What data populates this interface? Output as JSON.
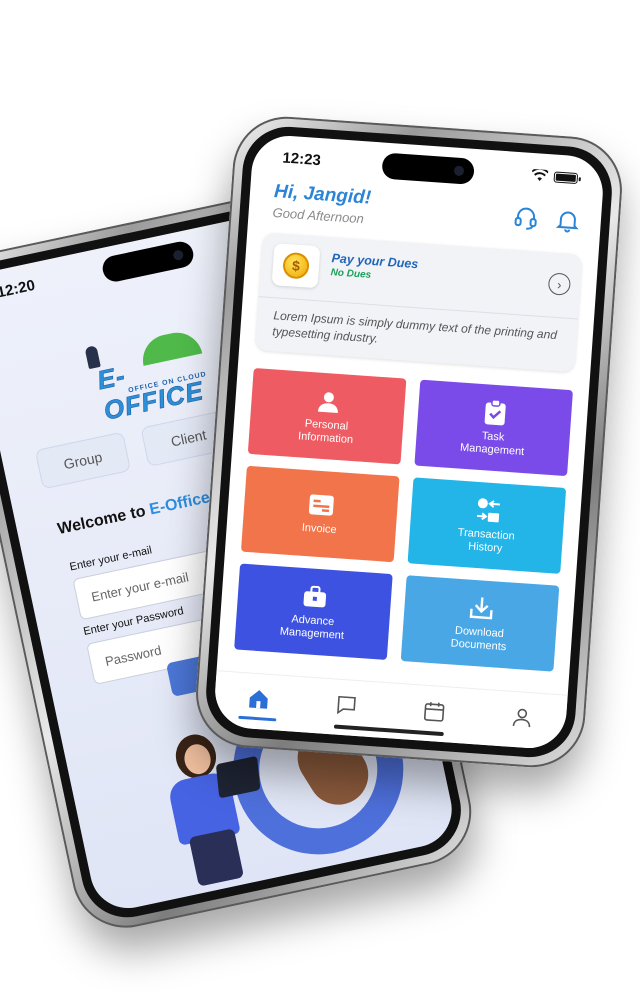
{
  "login_phone": {
    "status_time": "12:20",
    "logo": {
      "title": "E-OFFICE",
      "tagline": "OFFICE ON CLOUD"
    },
    "segments": [
      {
        "label": "Group"
      },
      {
        "label": "Client"
      }
    ],
    "welcome_prefix": "Welcome to ",
    "welcome_brand": "E-Office!",
    "email_label": "Enter your e-mail",
    "email_placeholder": "Enter your e-mail",
    "password_label": "Enter your Password",
    "password_placeholder": "Password"
  },
  "dashboard_phone": {
    "status_time": "12:23",
    "greeting": "Hi, Jangid!",
    "greeting_sub": "Good Afternoon",
    "dues": {
      "title": "Pay your Dues",
      "status": "No Dues",
      "coin_symbol": "$",
      "description": "Lorem Ipsum is simply dummy text of the printing and typesetting industry."
    },
    "tiles": [
      {
        "label": "Personal Information",
        "color": "#ef5b63",
        "icon": "user-icon"
      },
      {
        "label": "Task Management",
        "color": "#7b4be9",
        "icon": "clipboard-check-icon"
      },
      {
        "label": "Invoice",
        "color": "#f2744a",
        "icon": "invoice-icon"
      },
      {
        "label": "Transaction History",
        "color": "#23b4e8",
        "icon": "transaction-icon"
      },
      {
        "label": "Advance Management",
        "color": "#3d52e0",
        "icon": "briefcase-icon"
      },
      {
        "label": "Download Documents",
        "color": "#4aa7e6",
        "icon": "download-icon"
      }
    ],
    "tabbar": [
      {
        "icon": "home-icon",
        "active": true
      },
      {
        "icon": "chat-icon",
        "active": false
      },
      {
        "icon": "calendar-icon",
        "active": false
      },
      {
        "icon": "profile-icon",
        "active": false
      }
    ],
    "colors": {
      "primary": "#2b84d6",
      "success": "#19a15a"
    }
  }
}
